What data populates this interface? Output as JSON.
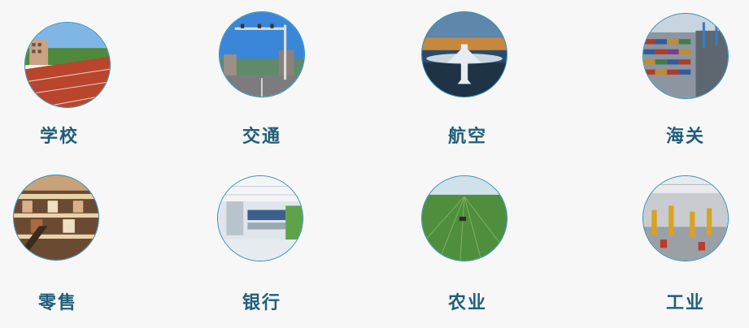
{
  "industries": [
    {
      "label": "学校",
      "icon": "school-running-track-photo"
    },
    {
      "label": "交通",
      "icon": "traffic-road-signal-photo"
    },
    {
      "label": "航空",
      "icon": "airport-terminal-photo"
    },
    {
      "label": "海关",
      "icon": "customs-container-port-photo"
    },
    {
      "label": "零售",
      "icon": "retail-shopping-mall-photo"
    },
    {
      "label": "银行",
      "icon": "bank-office-interior-photo"
    },
    {
      "label": "农业",
      "icon": "agriculture-green-field-photo"
    },
    {
      "label": "工业",
      "icon": "industrial-robot-factory-photo"
    }
  ],
  "colors": {
    "label": "#1f5e7a",
    "ring": "#2a8fb8",
    "background": "#f7f7f8"
  }
}
